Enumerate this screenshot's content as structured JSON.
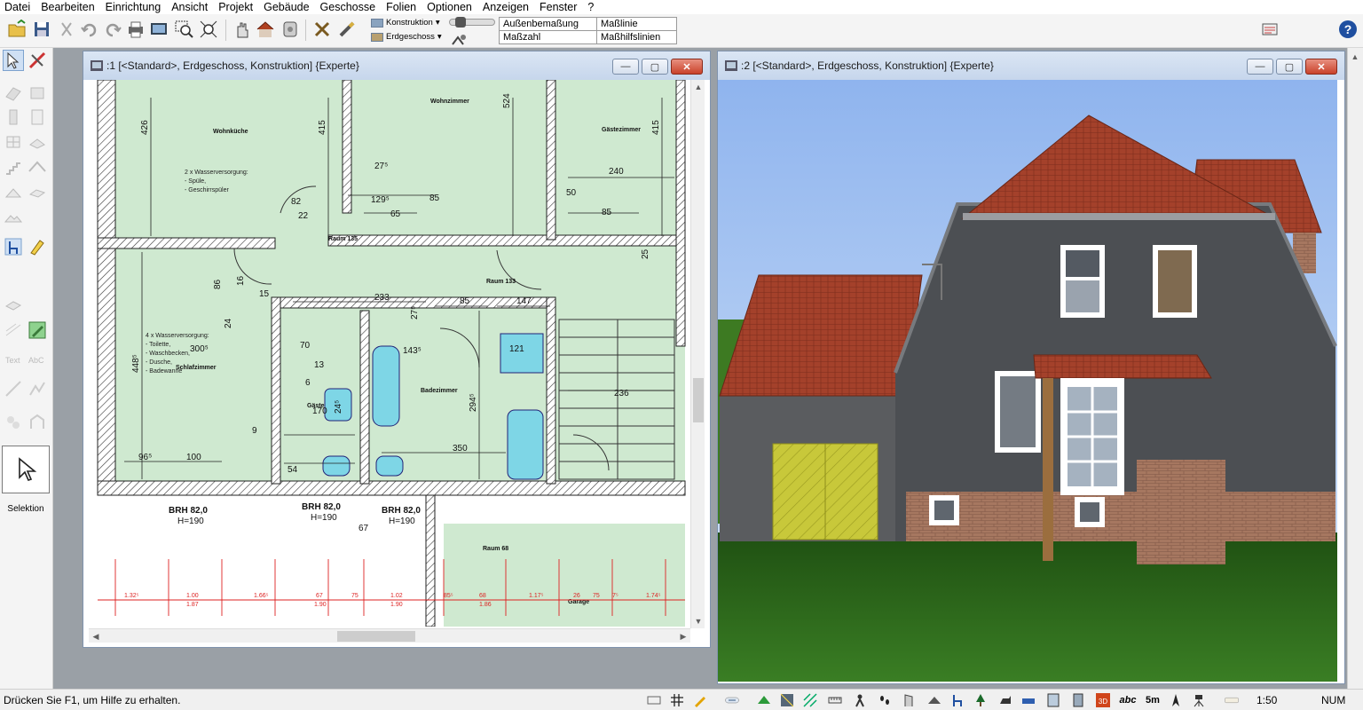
{
  "menu": [
    "Datei",
    "Bearbeiten",
    "Einrichtung",
    "Ansicht",
    "Projekt",
    "Gebäude",
    "Geschosse",
    "Folien",
    "Optionen",
    "Anzeigen",
    "Fenster",
    "?"
  ],
  "toolbar": {
    "layer_dropdown": "Konstruktion",
    "floor_dropdown": "Erdgeschoss",
    "dim_buttons": [
      "Außenbemaßung",
      "Maßlinie",
      "Maßzahl",
      "Maßhilfslinien"
    ]
  },
  "palette": {
    "selection_label": "Selektion"
  },
  "plan_window": {
    "title": ":1 [<Standard>, Erdgeschoss, Konstruktion] {Experte}",
    "rooms": {
      "wohnkueche": "Wohnküche",
      "wohnzimmer": "Wohnzimmer",
      "gaestezimmer": "Gästezimmer",
      "raum133": "Raum 133",
      "raum135": "Raum 135",
      "schlafzimmer": "Schlafzimmer",
      "badezimmer": "Badezimmer",
      "gaeste_wc": "Gäste",
      "raum68": "Raum 68",
      "garage": "Garage"
    },
    "notes": {
      "kitchen_1": "2 x Wasserversorgung:",
      "kitchen_2": "- Spüle,",
      "kitchen_3": "- Geschirrspüler",
      "bed_1": "4 x Wasserversorgung:",
      "bed_2": "- Toilette,",
      "bed_3": "- Waschbecken,",
      "bed_4": "- Dusche,",
      "bed_5": "- Badewanne"
    },
    "dims": {
      "d426": "426",
      "d415a": "415",
      "d524": "524",
      "d415b": "415",
      "d275": "27⁵",
      "d240": "240",
      "d82": "82",
      "d1295": "129⁵",
      "d85a": "85",
      "d50": "50",
      "d22": "22",
      "d65": "65",
      "d85b": "85",
      "d86": "86",
      "d16": "16",
      "d15": "15",
      "d233": "233",
      "d275b": "27⁵",
      "d85c": "85",
      "d147": "147",
      "d24": "24",
      "d3005": "300⁵",
      "d70": "70",
      "d13": "13",
      "d6": "6",
      "d4485": "448⁵",
      "d245": "24⁵",
      "d1435": "143⁵",
      "d121": "121",
      "d170": "170",
      "d2945": "294⁵",
      "d236": "236",
      "d9": "9",
      "d350": "350",
      "d965": "96⁵",
      "d100": "100",
      "d54": "54",
      "d25": "25",
      "d67": "67"
    },
    "openings": [
      {
        "label": "BRH 82,0",
        "height": "H=190"
      },
      {
        "label": "BRH 82,0",
        "height": "H=190"
      },
      {
        "label": "BRH 82,0",
        "height": "H=190"
      }
    ],
    "red_dims": [
      "1.32⁵",
      "1.00",
      "1.87",
      "1.66⁵",
      "67",
      "1.90",
      "75",
      "1.02",
      "1.90",
      "85⁵",
      "68",
      "1.86",
      "1.17⁵",
      "26",
      "75",
      "7⁵",
      "1.74⁵"
    ]
  },
  "view3d_window": {
    "title": ":2 [<Standard>, Erdgeschoss, Konstruktion] {Experte}"
  },
  "status": {
    "hint": "Drücken Sie F1, um Hilfe zu erhalten.",
    "scale": "1:50",
    "num": "NUM",
    "abc": "abc",
    "fivem": "5m"
  },
  "colors": {
    "plan_fill": "#cfe9d0",
    "roof": "#9e3a26",
    "wall": "#4c4f53",
    "brick": "#a0715c",
    "garage_door": "#c9c93a",
    "sky": "#a9c7f2",
    "grass": "#2f6e1d"
  }
}
